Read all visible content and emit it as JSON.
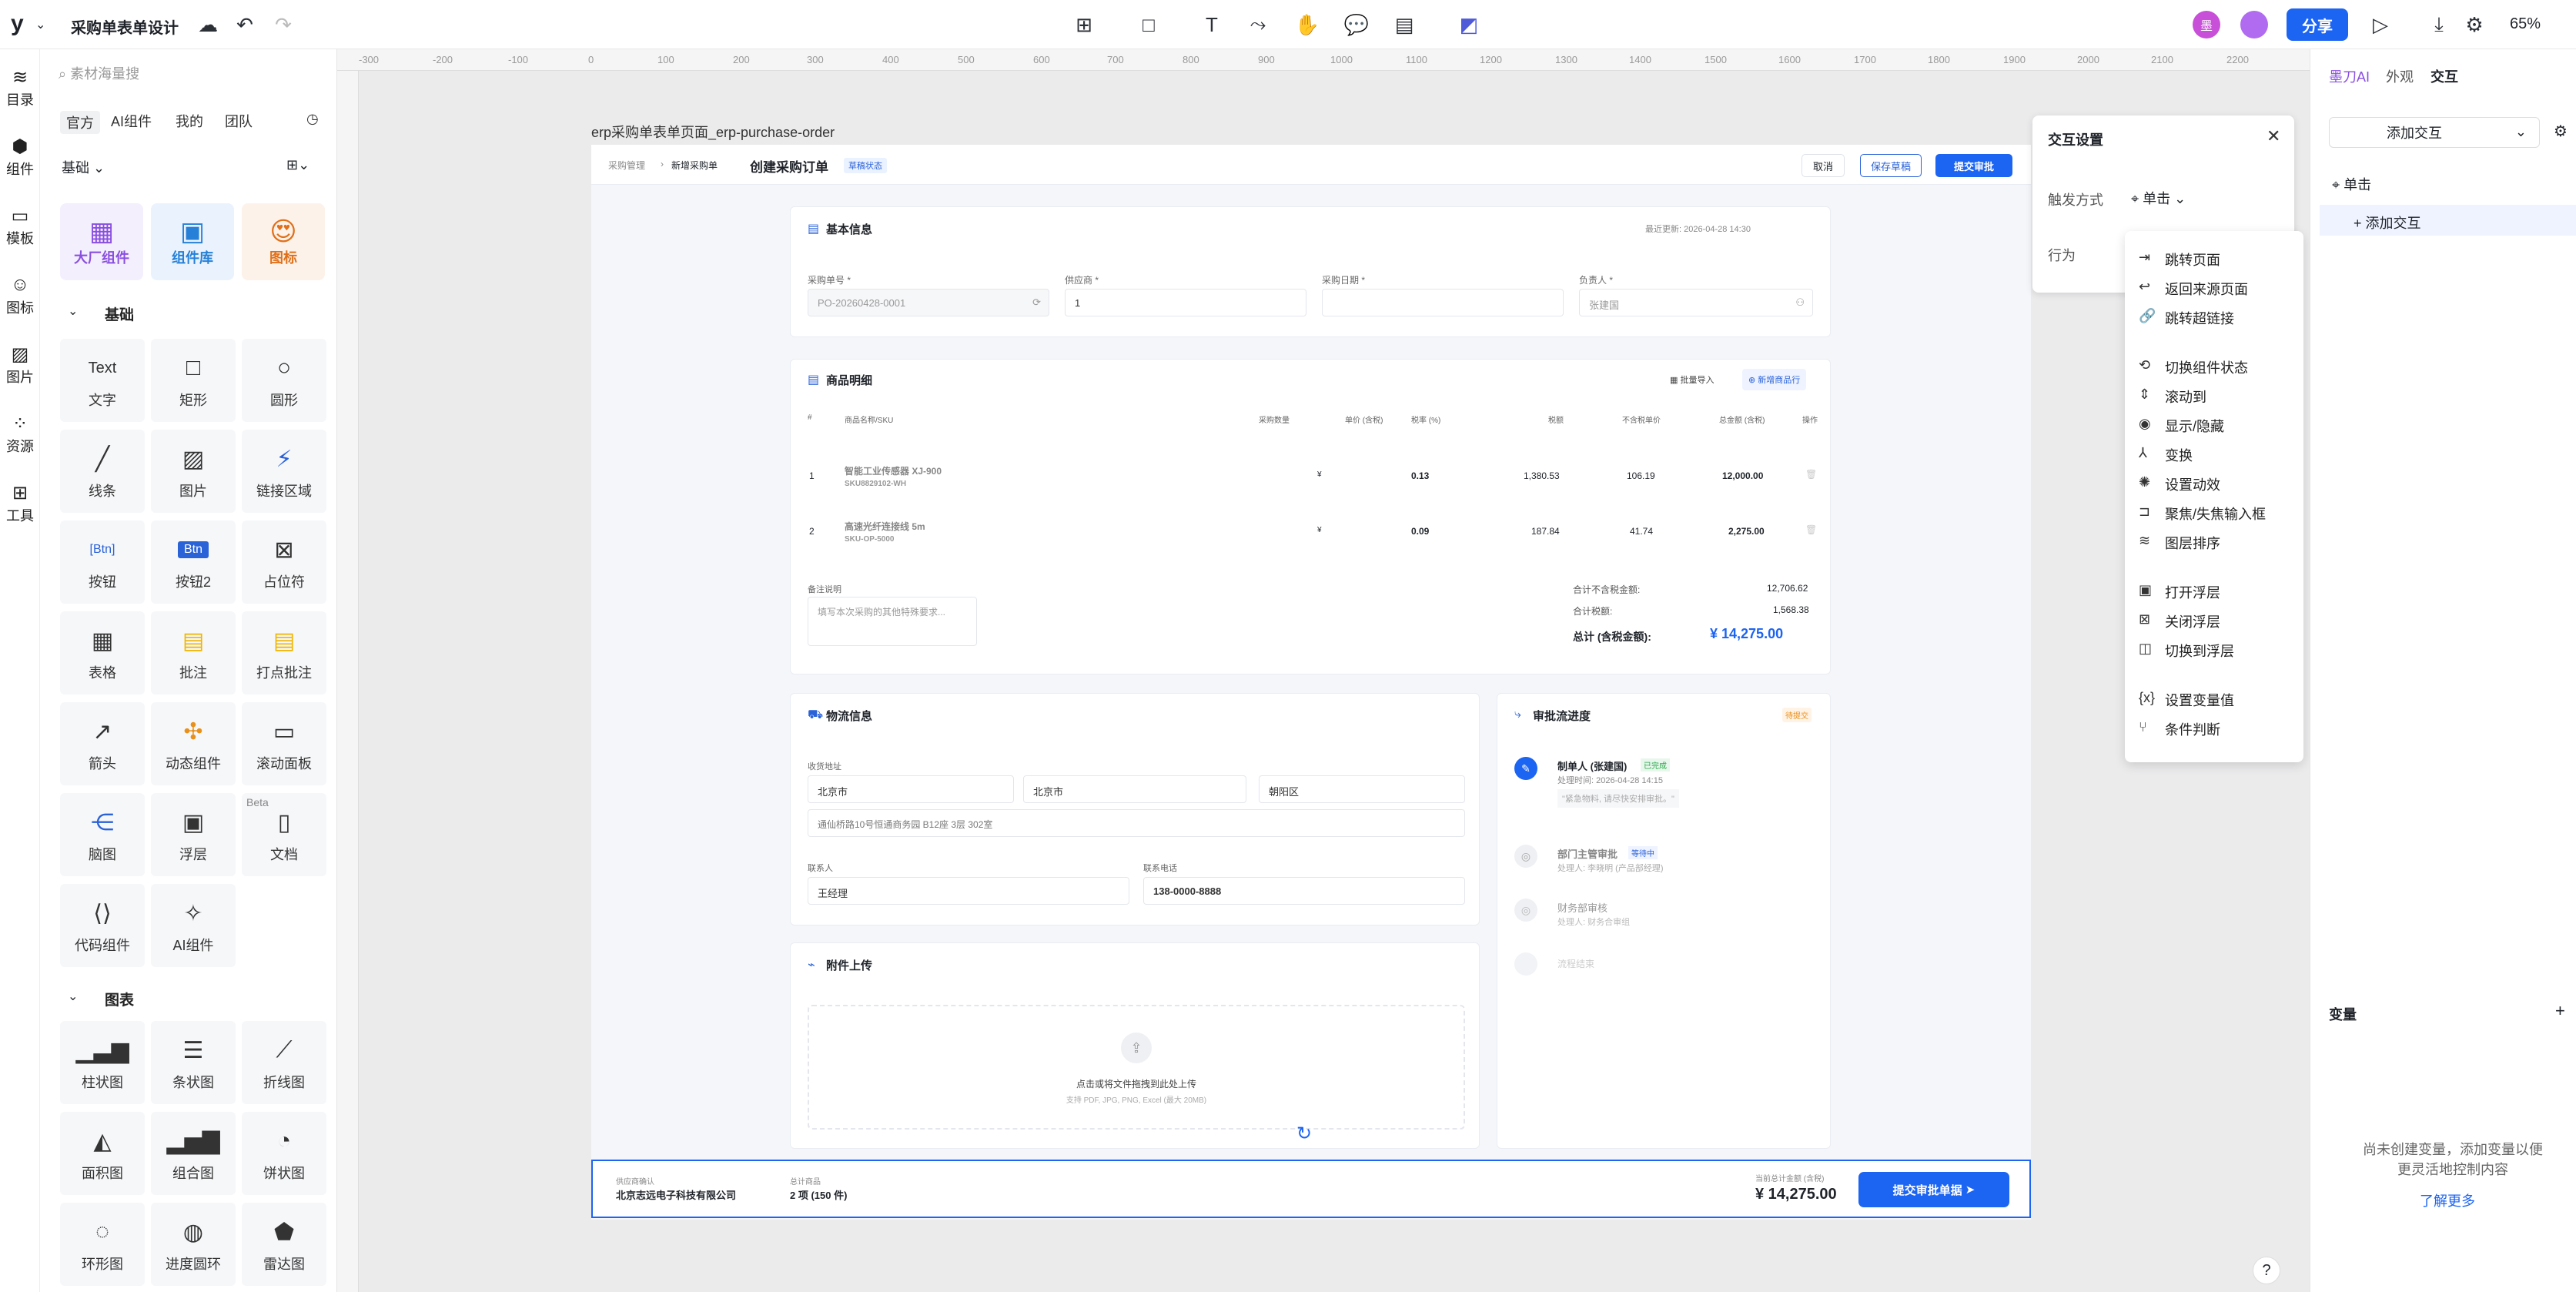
{
  "topbar": {
    "logo": "y",
    "title": "采购单表单设计",
    "share": "分享",
    "zoom": "65%"
  },
  "rail": [
    {
      "icon": "layers-icon",
      "label": "目录"
    },
    {
      "icon": "component-icon",
      "label": "组件"
    },
    {
      "icon": "template-icon",
      "label": "模板"
    },
    {
      "icon": "smile-icon",
      "label": "图标"
    },
    {
      "icon": "image-icon",
      "label": "图片"
    },
    {
      "icon": "resource-icon",
      "label": "资源"
    },
    {
      "icon": "tool-icon",
      "label": "工具"
    }
  ],
  "lib": {
    "search_placeholder": "素材海量搜",
    "tabs": [
      "官方",
      "AI组件",
      "我的",
      "团队"
    ],
    "group": "基础",
    "cards": [
      "大厂组件",
      "组件库",
      "图标"
    ],
    "sec_basic": "基础",
    "basic": [
      "文字",
      "矩形",
      "圆形",
      "线条",
      "图片",
      "链接区域",
      "按钮",
      "按钮2",
      "占位符",
      "表格",
      "批注",
      "打点批注",
      "箭头",
      "动态组件",
      "滚动面板",
      "脑图",
      "浮层",
      "文档",
      "代码组件",
      "AI组件"
    ],
    "text_label": "Text",
    "beta": "Beta",
    "sec_chart": "图表",
    "charts": [
      "柱状图",
      "条状图",
      "折线图",
      "面积图",
      "组合图",
      "饼状图",
      "环形图",
      "进度圆环",
      "雷达图"
    ]
  },
  "ruler": [
    "-300",
    "-200",
    "-100",
    "0",
    "100",
    "200",
    "300",
    "400",
    "500",
    "600",
    "700",
    "800",
    "900",
    "1000",
    "1100",
    "1200",
    "1300",
    "1400",
    "1500",
    "1600",
    "1700",
    "1800",
    "1900",
    "2000",
    "2100",
    "2200"
  ],
  "frame": {
    "name": "erp采购单表单页面_erp-purchase-order"
  },
  "form": {
    "crumb1": "采购管理",
    "crumb2": "新增采购单",
    "title": "创建采购订单",
    "status": "草稿状态",
    "cancel": "取消",
    "save": "保存草稿",
    "submit": "提交审批",
    "basic": {
      "title": "基本信息",
      "updated": "最近更新: 2026-04-28 14:30",
      "f1": "采购单号 *",
      "v1": "PO-20260428-0001",
      "f2": "供应商 *",
      "v2": "1",
      "f3": "采购日期 *",
      "f4": "负责人 *",
      "v4": "张建国"
    },
    "items": {
      "title": "商品明细",
      "import": "批量导入",
      "add": "新增商品行",
      "cols": [
        "#",
        "商品名称/SKU",
        "采购数量",
        "单价 (含税)",
        "税率 (%)",
        "税额",
        "不含税单价",
        "总金额 (含税)",
        "操作"
      ],
      "rows": [
        {
          "no": "1",
          "name": "智能工业传感器 XJ-900",
          "sku": "SKU8829102-WH",
          "price": "¥",
          "rate": "0.13",
          "tax": "1,380.53",
          "net": "106.19",
          "total": "12,000.00"
        },
        {
          "no": "2",
          "name": "高速光纤连接线 5m",
          "sku": "SKU-OP-5000",
          "price": "¥",
          "rate": "0.09",
          "tax": "187.84",
          "net": "41.74",
          "total": "2,275.00"
        }
      ],
      "remark_label": "备注说明",
      "remark_ph": "填写本次采购的其他特殊要求...",
      "sum1_l": "合计不含税金额:",
      "sum1_v": "12,706.62",
      "sum2_l": "合计税额:",
      "sum2_v": "1,568.38",
      "total_l": "总计 (含税金额):",
      "total_v": "¥ 14,275.00"
    },
    "logistics": {
      "title": "物流信息",
      "addr_label": "收货地址",
      "p": "北京市",
      "c": "北京市",
      "d": "朝阳区",
      "addr": "通仙桥路10号恒通商务园 B12座 3层 302室",
      "contact_l": "联系人",
      "contact": "王经理",
      "phone_l": "联系电话",
      "phone": "138-0000-8888"
    },
    "approval": {
      "title": "审批流进度",
      "badge": "待提交",
      "s1": "制单人 (张建国)",
      "s1b": "已完成",
      "s1t": "处理时间: 2026-04-28 14:15",
      "s1c": "\"紧急物料, 请尽快安排审批。\"",
      "s2": "部门主管审批",
      "s2b": "等待中",
      "s2t": "处理人: 李晓明 (产品部经理)",
      "s3": "财务部审核",
      "s3t": "处理人: 财务合审组",
      "s4": "流程结束"
    },
    "attach": {
      "title": "附件上传",
      "hint": "点击或将文件拖拽到此处上传",
      "sub": "支持 PDF, JPG, PNG, Excel (最大 20MB)"
    },
    "footer": {
      "sup_l": "供应商确认",
      "sup": "北京志远电子科技有限公司",
      "cnt_l": "总计商品",
      "cnt": "2 项 (150 件)",
      "amt_l": "当前总计金额 (含税)",
      "amt": "¥ 14,275.00",
      "btn": "提交审批单据"
    }
  },
  "interact": {
    "title": "交互设置",
    "trigger_l": "触发方式",
    "trigger": "单击",
    "action_l": "行为"
  },
  "menu": [
    "跳转页面",
    "返回来源页面",
    "跳转超链接",
    "切换组件状态",
    "滚动到",
    "显示/隐藏",
    "变换",
    "设置动效",
    "聚焦/失焦输入框",
    "图层排序",
    "打开浮层",
    "关闭浮层",
    "切换到浮层",
    "设置变量值",
    "条件判断"
  ],
  "right": {
    "tabs": [
      "墨刀AI",
      "外观",
      "交互"
    ],
    "add": "添加交互",
    "event": "单击",
    "add2": "添加交互",
    "var_title": "变量",
    "var_empty": "尚未创建变量，添加变量以便更灵活地控制内容",
    "learn": "了解更多",
    "help": "?"
  },
  "colors": {
    "accent": "#1c64f2",
    "canvas": "#ebebec"
  }
}
